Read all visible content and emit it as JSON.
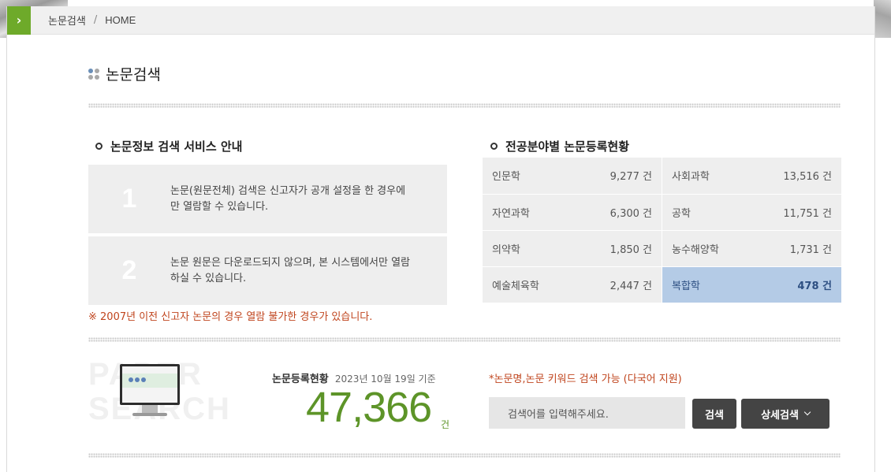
{
  "breadcrumb": {
    "current": "논문검색",
    "separator": "/",
    "home": "HOME"
  },
  "page_title": "논문검색",
  "guide": {
    "heading": "논문정보 검색 서비스 안내",
    "items": [
      {
        "num": "1",
        "text": "논문(원문전체) 검색은 신고자가 공개 설정을 한 경우에만 열람할 수 있습니다."
      },
      {
        "num": "2",
        "text": "논문 원문은 다운로드되지 않으며, 본 시스템에서만 열람하실 수 있습니다."
      }
    ],
    "notice": "※ 2007년 이전 신고자 논문의 경우 열람 불가한 경우가 있습니다."
  },
  "stats": {
    "heading": "전공분야별 논문등록현황",
    "rows": [
      [
        {
          "name": "인문학",
          "value": "9,277 건"
        },
        {
          "name": "사회과학",
          "value": "13,516 건"
        }
      ],
      [
        {
          "name": "자연과학",
          "value": "6,300 건"
        },
        {
          "name": "공학",
          "value": "11,751 건"
        }
      ],
      [
        {
          "name": "의약학",
          "value": "1,850 건"
        },
        {
          "name": "농수해양학",
          "value": "1,731 건"
        }
      ],
      [
        {
          "name": "예술체육학",
          "value": "2,447 건"
        },
        {
          "name": "복합학",
          "value": "478 건"
        }
      ]
    ]
  },
  "registration": {
    "background_text": [
      "PAPER",
      "SEARCH"
    ],
    "title": "논문등록현황",
    "date": "2023년 10월 19일 기준",
    "count": "47,366",
    "unit": "건"
  },
  "search": {
    "hint": "*논문명,논문 키워드 검색 가능 (다국어 지원)",
    "placeholder": "검색어를 입력해주세요.",
    "search_label": "검색",
    "advanced_label": "상세검색"
  },
  "colors": {
    "accent_green": "#6eaa2a",
    "count_green": "#5d9428",
    "notice_red": "#c0451e",
    "highlight_blue": "#b4cbe6",
    "button_dark": "#444444"
  }
}
